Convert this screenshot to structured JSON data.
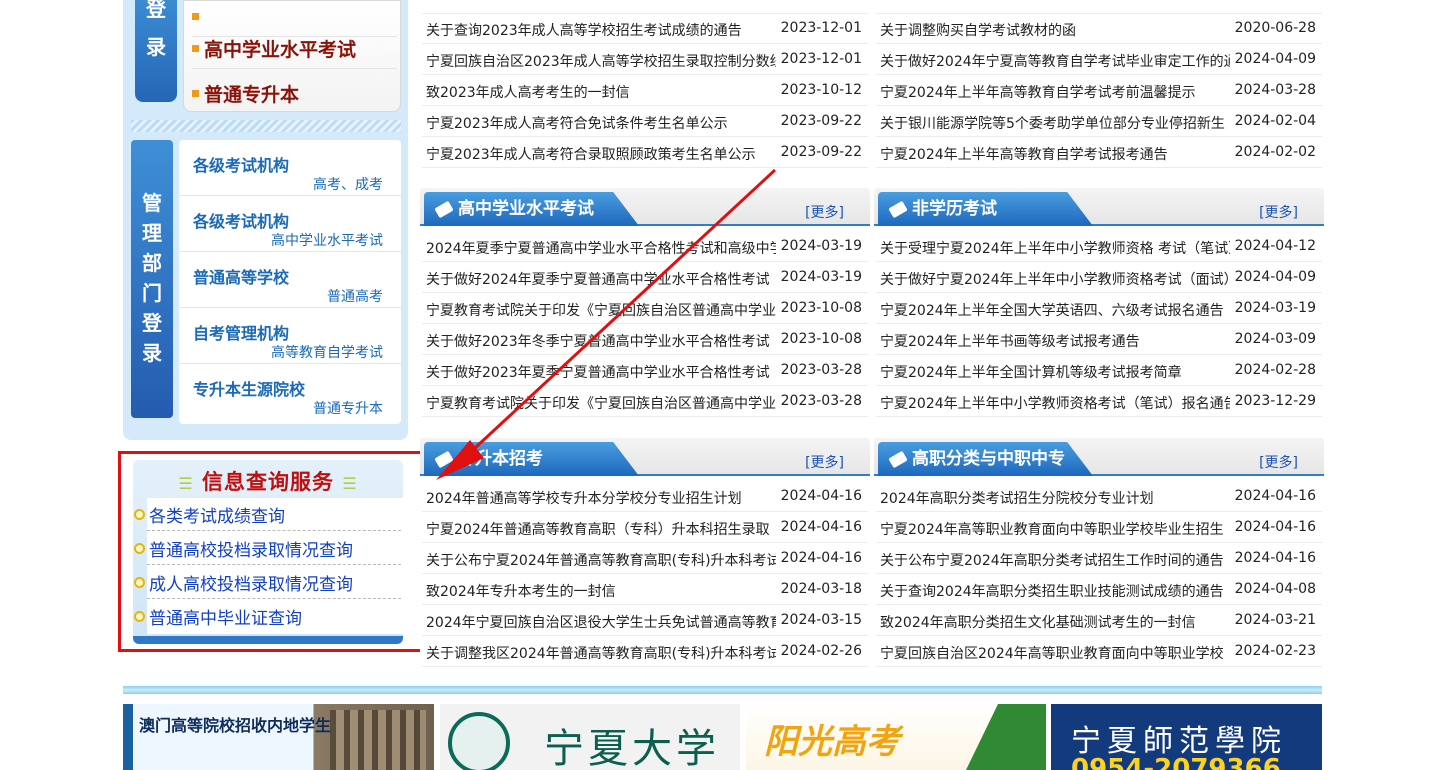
{
  "sidebar": {
    "login_tab": [
      "登",
      "录"
    ],
    "login_items": [
      "高中学业水平考试",
      "普通专升本"
    ],
    "mgmt_tab": [
      "管",
      "理",
      "部",
      "门",
      "登",
      "录"
    ],
    "mgmt_items": [
      {
        "title": "各级考试机构",
        "sub": "高考、成考"
      },
      {
        "title": "各级考试机构",
        "sub": "高中学业水平考试"
      },
      {
        "title": "普通高等学校",
        "sub": "普通高考"
      },
      {
        "title": "自考管理机构",
        "sub": "高等教育自学考试"
      },
      {
        "title": "专升本生源院校",
        "sub": "普通专升本"
      }
    ],
    "info": {
      "title": "信息查询服务",
      "items": [
        "各类考试成绩查询",
        "普通高校投档录取情况查询",
        "成人高校投档录取情况查询",
        "普通高中毕业证查询"
      ]
    }
  },
  "top_lists": {
    "left": [
      {
        "title": "关于查询2023年成人高等学校招生考试成绩的通告",
        "date": "2023-12-01"
      },
      {
        "title": "宁夏回族自治区2023年成人高等学校招生录取控制分数线",
        "date": "2023-12-01"
      },
      {
        "title": "致2023年成人高考考生的一封信",
        "date": "2023-10-12"
      },
      {
        "title": "宁夏2023年成人高考符合免试条件考生名单公示",
        "date": "2023-09-22"
      },
      {
        "title": "宁夏2023年成人高考符合录取照顾政策考生名单公示",
        "date": "2023-09-22"
      }
    ],
    "right": [
      {
        "title": "关于调整购买自学考试教材的函",
        "date": "2020-06-28"
      },
      {
        "title": "关于做好2024年宁夏高等教育自学考试毕业审定工作的通知",
        "date": "2024-04-09"
      },
      {
        "title": "宁夏2024年上半年高等教育自学考试考前温馨提示",
        "date": "2024-03-28"
      },
      {
        "title": "关于银川能源学院等5个委考助学单位部分专业停招新生",
        "date": "2024-02-04"
      },
      {
        "title": "宁夏2024年上半年高等教育自学考试报考通告",
        "date": "2024-02-02"
      }
    ]
  },
  "panels": [
    {
      "title": "高中学业水平考试",
      "more": "[更多]",
      "rows": [
        {
          "title": "2024年夏季宁夏普通高中学业水平合格性考试和高级中学",
          "date": "2024-03-19"
        },
        {
          "title": "关于做好2024年夏季宁夏普通高中学业水平合格性考试",
          "date": "2024-03-19"
        },
        {
          "title": "宁夏教育考试院关于印发《宁夏回族自治区普通高中学业",
          "date": "2023-10-08"
        },
        {
          "title": "关于做好2023年冬季宁夏普通高中学业水平合格性考试",
          "date": "2023-10-08"
        },
        {
          "title": "关于做好2023年夏季宁夏普通高中学业水平合格性考试",
          "date": "2023-03-28"
        },
        {
          "title": "宁夏教育考试院关于印发《宁夏回族自治区普通高中学业",
          "date": "2023-03-28"
        }
      ]
    },
    {
      "title": "非学历考试",
      "more": "[更多]",
      "rows": [
        {
          "title": "关于受理宁夏2024年上半年中小学教师资格 考试（笔试）",
          "date": "2024-04-12"
        },
        {
          "title": "关于做好宁夏2024年上半年中小学教师资格考试（面试）",
          "date": "2024-04-09"
        },
        {
          "title": "宁夏2024年上半年全国大学英语四、六级考试报名通告",
          "date": "2024-03-19"
        },
        {
          "title": "宁夏2024年上半年书画等级考试报考通告",
          "date": "2024-03-09"
        },
        {
          "title": "宁夏2024年上半年全国计算机等级考试报考简章",
          "date": "2024-02-28"
        },
        {
          "title": "宁夏2024年上半年中小学教师资格考试（笔试）报名通告",
          "date": "2023-12-29"
        }
      ]
    },
    {
      "title": "专升本招考",
      "more": "[更多]",
      "rows": [
        {
          "title": "2024年普通高等学校专升本分学校分专业招生计划",
          "date": "2024-04-16"
        },
        {
          "title": "宁夏2024年普通高等教育高职（专科）升本科招生录取",
          "date": "2024-04-16"
        },
        {
          "title": "关于公布宁夏2024年普通高等教育高职(专科)升本科考试",
          "date": "2024-04-16"
        },
        {
          "title": "致2024年专升本考生的一封信",
          "date": "2024-03-18"
        },
        {
          "title": "2024年宁夏回族自治区退役大学生士兵免试普通高等教育",
          "date": "2024-03-15"
        },
        {
          "title": "关于调整我区2024年普通高等教育高职(专科)升本科考试",
          "date": "2024-02-26"
        }
      ]
    },
    {
      "title": "高职分类与中职中专",
      "more": "[更多]",
      "rows": [
        {
          "title": "2024年高职分类考试招生分院校分专业计划",
          "date": "2024-04-16"
        },
        {
          "title": "宁夏2024年高等职业教育面向中等职业学校毕业生招生",
          "date": "2024-04-16"
        },
        {
          "title": "关于公布宁夏2024年高职分类考试招生工作时间的通告",
          "date": "2024-04-16"
        },
        {
          "title": "关于查询2024年高职分类招生职业技能测试成绩的通告",
          "date": "2024-04-08"
        },
        {
          "title": "致2024年高职分类招生文化基础测试考生的一封信",
          "date": "2024-03-21"
        },
        {
          "title": "宁夏回族自治区2024年高等职业教育面向中等职业学校",
          "date": "2024-02-23"
        }
      ]
    }
  ],
  "banners": {
    "macau": "澳门高等院校招收内地学生",
    "ningxia_university": "宁夏大学",
    "sunshine": "阳光高考",
    "normal_university": "宁夏師范學院",
    "phone": "0954-2079366"
  },
  "colors": {
    "accent_blue": "#1d68bd",
    "link_blue": "#1c53b2",
    "highlight_red": "#e01010",
    "title_red": "#c10e0e",
    "login_text": "#8a1208"
  }
}
